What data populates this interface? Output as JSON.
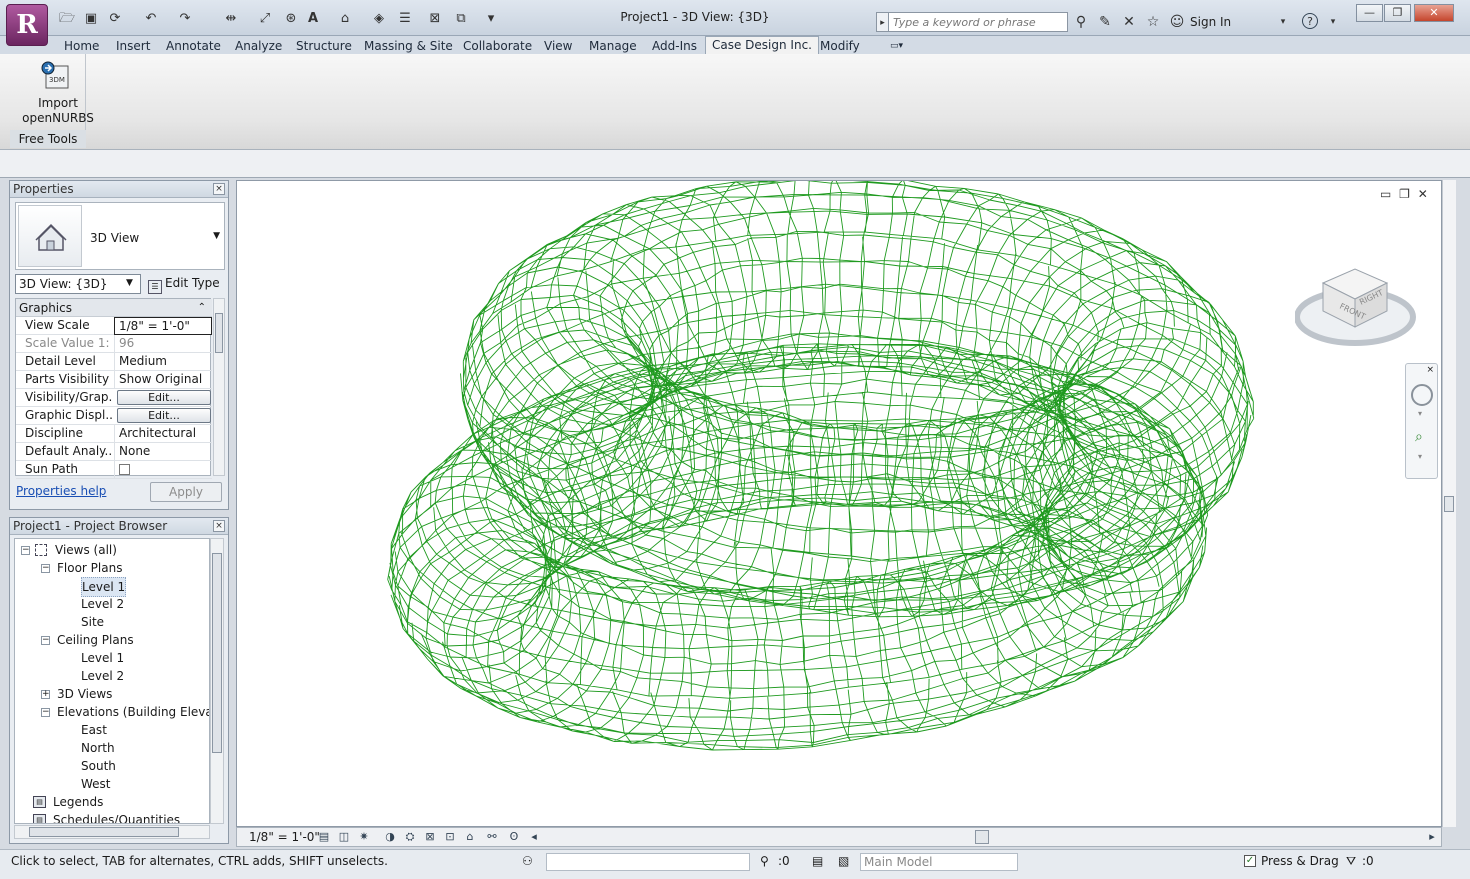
{
  "title_bar": {
    "app_letter": "R",
    "window_title": "Project1 - 3D View: {3D}",
    "search_placeholder": "Type a keyword or phrase",
    "sign_in": "Sign In",
    "help": "?"
  },
  "ribbon_tabs": [
    "Home",
    "Insert",
    "Annotate",
    "Analyze",
    "Structure",
    "Massing & Site",
    "Collaborate",
    "View",
    "Manage",
    "Add-Ins",
    "Case Design Inc.",
    "Modify"
  ],
  "active_tab": "Case Design Inc.",
  "ribbon": {
    "import_badge": "3DM",
    "import_label_line1": "Import",
    "import_label_line2": "openNURBS",
    "panel_title": "Free Tools"
  },
  "properties": {
    "title": "Properties",
    "type_name": "3D View",
    "view_select": "3D View: {3D}",
    "edit_type": "Edit Type",
    "section": "Graphics",
    "rows": [
      {
        "key": "View Scale",
        "value": "1/8\" = 1'-0\""
      },
      {
        "key": "Scale Value    1:",
        "value": "96"
      },
      {
        "key": "Detail Level",
        "value": "Medium"
      },
      {
        "key": "Parts Visibility",
        "value": "Show Original"
      },
      {
        "key": "Visibility/Grap...",
        "value": "Edit..."
      },
      {
        "key": "Graphic Displ...",
        "value": "Edit..."
      },
      {
        "key": "Discipline",
        "value": "Architectural"
      },
      {
        "key": "Default Analy...",
        "value": "None"
      },
      {
        "key": "Sun Path",
        "value": ""
      }
    ],
    "help_link": "Properties help",
    "apply": "Apply"
  },
  "browser": {
    "title": "Project1 - Project Browser",
    "nodes": [
      {
        "label": "Views (all)",
        "depth": 0
      },
      {
        "label": "Floor Plans",
        "depth": 1
      },
      {
        "label": "Level 1",
        "depth": 2
      },
      {
        "label": "Level 2",
        "depth": 2
      },
      {
        "label": "Site",
        "depth": 2
      },
      {
        "label": "Ceiling Plans",
        "depth": 1
      },
      {
        "label": "Level 1",
        "depth": 2
      },
      {
        "label": "Level 2",
        "depth": 2
      },
      {
        "label": "3D Views",
        "depth": 1
      },
      {
        "label": "Elevations (Building Elevation)",
        "depth": 1
      },
      {
        "label": "East",
        "depth": 2
      },
      {
        "label": "North",
        "depth": 2
      },
      {
        "label": "South",
        "depth": 2
      },
      {
        "label": "West",
        "depth": 2
      },
      {
        "label": "Legends",
        "depth": 0
      },
      {
        "label": "Schedules/Quantities",
        "depth": 0
      }
    ],
    "selected": "Level 1"
  },
  "viewcube": {
    "front": "FRONT",
    "right": "RIGHT"
  },
  "view_bar": {
    "scale": "1/8\" = 1'-0\""
  },
  "status_bar": {
    "hint": "Click to select, TAB for alternates, CTRL adds, SHIFT unselects.",
    "count1": ":0",
    "model": "Main Model",
    "press_drag": "Press & Drag",
    "filter_count": ":0"
  },
  "colors": {
    "wireframe": "#1f9a1f",
    "accent": "#7a2a6e"
  }
}
